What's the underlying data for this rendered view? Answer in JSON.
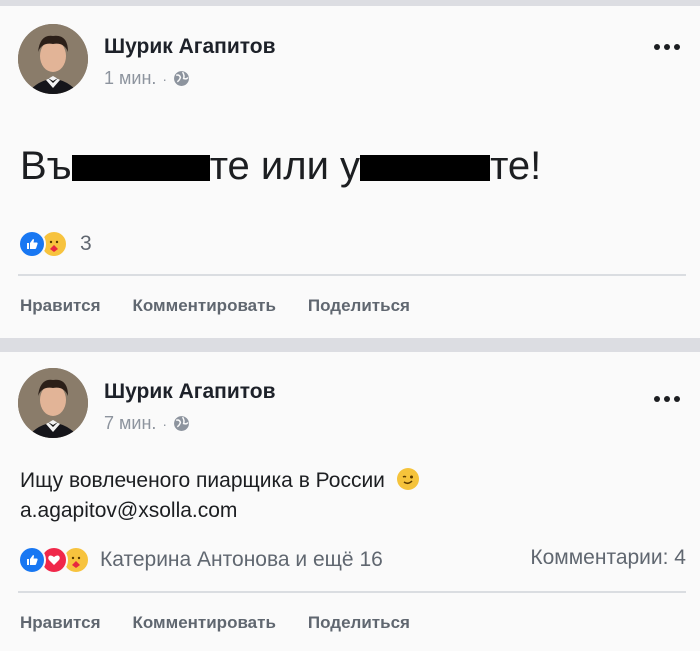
{
  "posts": [
    {
      "author": "Шурик Агапитов",
      "time": "1 мин.",
      "text_parts": [
        "Въ",
        "те или у",
        "те!"
      ],
      "reaction_count": "3",
      "actions": {
        "like": "Нравится",
        "comment": "Комментировать",
        "share": "Поделиться"
      }
    },
    {
      "author": "Шурик Агапитов",
      "time": "7 мин.",
      "line1": "Ищу вовлеченого пиарщика в России",
      "line2": "a.agapitov@xsolla.com",
      "reaction_names": "Катерина Антонова и ещё 16",
      "comments": "Комментарии: 4",
      "actions": {
        "like": "Нравится",
        "comment": "Комментировать",
        "share": "Поделиться"
      }
    }
  ],
  "colors": {
    "like": "#1877f2",
    "love": "#f0284a",
    "care": "#f7c33e",
    "muted": "#606770"
  }
}
